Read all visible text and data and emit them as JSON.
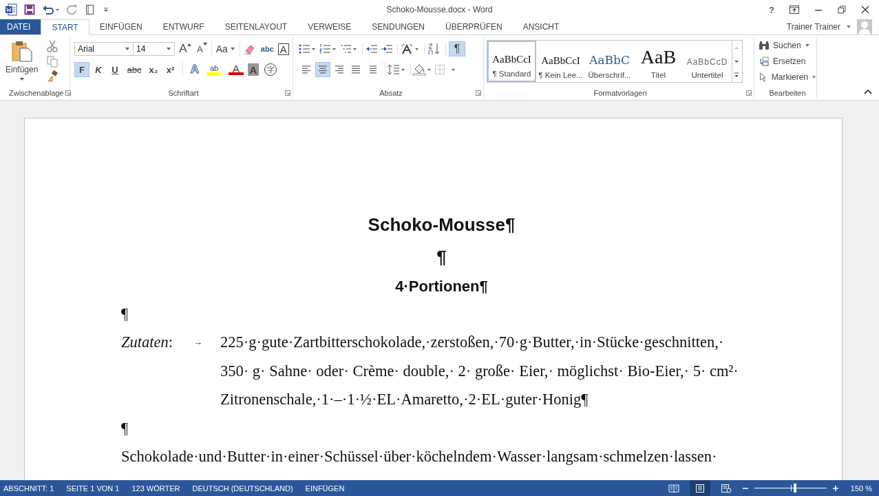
{
  "title_bar": {
    "title": "Schoko-Mousse.docx - Word",
    "help": "?"
  },
  "account": {
    "name": "Trainer Trainer"
  },
  "tabs": [
    {
      "label": "DATEI",
      "kind": "file",
      "selected": false
    },
    {
      "label": "START",
      "kind": "tab",
      "selected": true
    },
    {
      "label": "EINFÜGEN",
      "kind": "tab",
      "selected": false
    },
    {
      "label": "ENTWURF",
      "kind": "tab",
      "selected": false
    },
    {
      "label": "SEITENLAYOUT",
      "kind": "tab",
      "selected": false
    },
    {
      "label": "VERWEISE",
      "kind": "tab",
      "selected": false
    },
    {
      "label": "SENDUNGEN",
      "kind": "tab",
      "selected": false
    },
    {
      "label": "ÜBERPRÜFEN",
      "kind": "tab",
      "selected": false
    },
    {
      "label": "ANSICHT",
      "kind": "tab",
      "selected": false
    }
  ],
  "ribbon": {
    "clipboard": {
      "label": "Zwischenablage",
      "paste": "Einfügen"
    },
    "font": {
      "label": "Schriftart",
      "font_name": "Arial",
      "font_size": "14",
      "row1": [
        {
          "kind": "grow",
          "label": "A"
        },
        {
          "kind": "shrink",
          "label": "A"
        },
        {
          "kind": "case",
          "label": "Aa"
        },
        {
          "kind": "clear"
        },
        {
          "kind": "phonetic",
          "label": "abc"
        },
        {
          "kind": "border",
          "label": "A"
        }
      ],
      "row2": [
        {
          "kind": "bold",
          "label": "F",
          "on": true
        },
        {
          "kind": "italic",
          "label": "K",
          "on": false
        },
        {
          "kind": "underline",
          "label": "U",
          "on": false
        },
        {
          "kind": "strike",
          "label": "abc",
          "on": false
        },
        {
          "kind": "sub",
          "label": "x₂",
          "on": false
        },
        {
          "kind": "sup",
          "label": "x²",
          "on": false
        },
        {
          "kind": "effect",
          "label": "A"
        },
        {
          "kind": "highlight",
          "label": "ab"
        },
        {
          "kind": "color",
          "label": "A"
        },
        {
          "kind": "shade",
          "label": "A"
        },
        {
          "kind": "enclose",
          "label": "字"
        }
      ]
    },
    "paragraph": {
      "label": "Absatz",
      "pilcrow": {
        "label": "¶",
        "on": true
      },
      "alignments": [
        {
          "kind": "left",
          "on": false
        },
        {
          "kind": "center",
          "on": true
        },
        {
          "kind": "right",
          "on": false
        },
        {
          "kind": "justify",
          "on": false
        },
        {
          "kind": "distributed",
          "on": false
        }
      ]
    },
    "styles": {
      "label": "Formatvorlagen",
      "items": [
        {
          "preview": "AaBbCcI",
          "name": "¶ Standard",
          "kind": "normal",
          "selected": true
        },
        {
          "preview": "AaBbCcI",
          "name": "¶ Kein Lee...",
          "kind": "normal",
          "selected": false
        },
        {
          "preview": "AaBbC",
          "name": "Überschrif...",
          "kind": "heading",
          "selected": false
        },
        {
          "preview": "AaB",
          "name": "Titel",
          "kind": "title",
          "selected": false
        },
        {
          "preview": "AaBbCcD",
          "name": "Untertitel",
          "kind": "subtitle",
          "selected": false
        }
      ]
    },
    "editing": {
      "label": "Bearbeiten",
      "items": [
        {
          "label": "Suchen",
          "kind": "find"
        },
        {
          "label": "Ersetzen",
          "kind": "replace"
        },
        {
          "label": "Markieren",
          "kind": "select"
        }
      ]
    }
  },
  "document": {
    "paragraphs": [
      {
        "kind": "title",
        "text": "Schoko-Mousse¶"
      },
      {
        "kind": "title",
        "text": "¶"
      },
      {
        "kind": "subtitle",
        "text": "4·Portionen¶"
      },
      {
        "kind": "body",
        "text": "¶"
      },
      {
        "kind": "ingredients",
        "label": "*Zutaten*:",
        "tab": "→",
        "lines": [
          "225·g·gute·Zartbitterschokolade,·zerstoßen,·70·g·Butter,·in·Stücke·geschnitten,·",
          "350· g· Sahne· oder· Crème· double,· 2· große· Eier,· möglichst· Bio-Eier,· 5· cm²·",
          "Zitronenschale,·1·–·1·½·EL·Amaretto,·2·EL·guter·Honig¶"
        ]
      },
      {
        "kind": "body",
        "text": "¶"
      },
      {
        "kind": "body",
        "text": "Schokolade·und·Butter·in·einer·Schüssel·über·köchelndem·Wasser·langsam·schmelzen·lassen·"
      }
    ]
  },
  "status_bar": {
    "items": [
      "ABSCHNITT: 1",
      "SEITE 1 VON 1",
      "123 WÖRTER",
      "DEUTSCH (DEUTSCHLAND)",
      "EINFÜGEN"
    ],
    "views": [
      {
        "kind": "read",
        "selected": false
      },
      {
        "kind": "print",
        "selected": true
      },
      {
        "kind": "web",
        "selected": false
      }
    ],
    "zoom": {
      "level": 0.56,
      "reading": "150 %"
    }
  }
}
